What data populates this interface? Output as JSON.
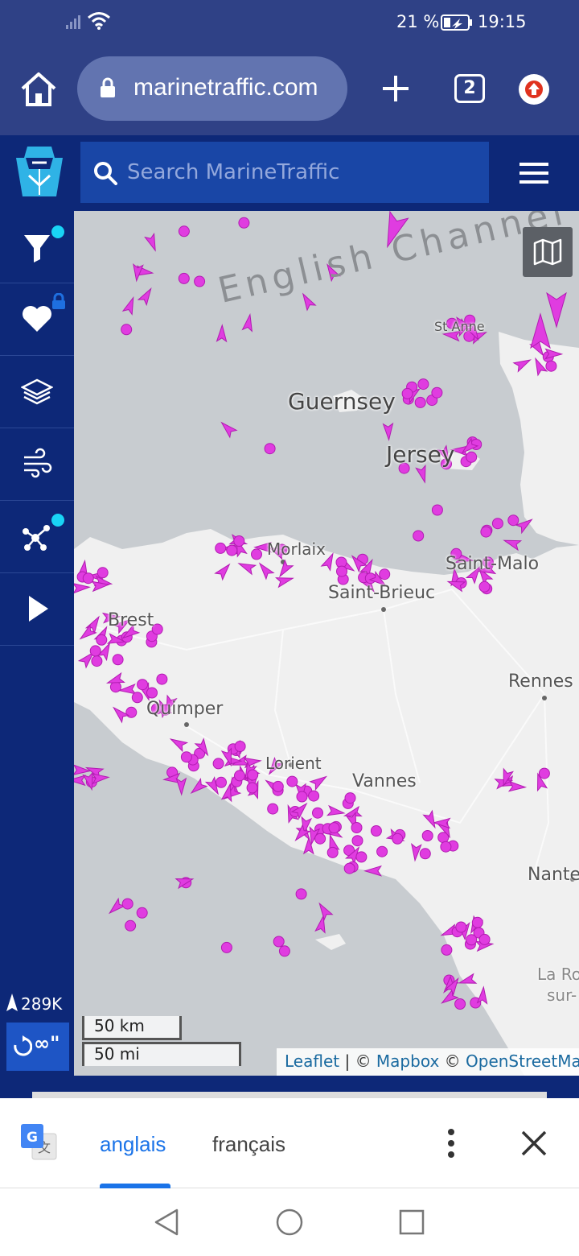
{
  "status_bar": {
    "battery_percent": "21 %",
    "time": "19:15"
  },
  "browser": {
    "url": "marinetraffic.com",
    "tab_count": "2"
  },
  "header": {
    "search_placeholder": "Search MarineTraffic"
  },
  "sidebar": {
    "buttons": [
      {
        "name": "filter",
        "icon": "filter-icon",
        "badge": "dot"
      },
      {
        "name": "favorites",
        "icon": "heart-icon",
        "badge": "lock"
      },
      {
        "name": "layers",
        "icon": "layers-icon"
      },
      {
        "name": "weather",
        "icon": "wind-icon"
      },
      {
        "name": "network",
        "icon": "network-icon",
        "badge": "dot"
      },
      {
        "name": "play",
        "icon": "play-icon"
      }
    ],
    "vessel_count": "289K",
    "refresh_label": "∞\""
  },
  "map": {
    "sea_label": "English Channel",
    "places": {
      "guernsey": "Guernsey",
      "jersey": "Jersey",
      "st_anne": "St Anne",
      "brest": "Brest",
      "quimper": "Quimper",
      "lorient": "Lorient",
      "vannes": "Vannes",
      "saint_brieuc": "Saint-Brieuc",
      "saint_malo": "Saint-Malo",
      "rennes": "Rennes",
      "nantes": "Nante",
      "morlaix": "Morlaix",
      "la_roche_1": "La Ro",
      "la_roche_2": "sur-"
    },
    "scale": {
      "km": "50 km",
      "mi": "50 mi"
    },
    "attribution": {
      "leaflet": "Leaflet",
      "sep": " | © ",
      "mapbox": "Mapbox",
      "sep2": " © ",
      "osm": "OpenStreetMap"
    },
    "colors": {
      "sea": "#c8ccd0",
      "land": "#f0f0f0",
      "vessel": "#e040e0"
    }
  },
  "translate_bar": {
    "source_lang": "anglais",
    "target_lang": "français"
  }
}
